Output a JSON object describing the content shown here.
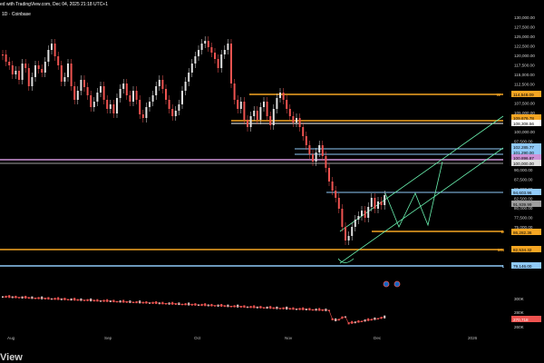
{
  "header": {
    "line1": "ed with TradingView.com, Dec 04, 2025 21:18 UTC+1",
    "line2": "1D · Coinbase"
  },
  "price_axis": [
    "130,000.00",
    "127,500.00",
    "125,000.00",
    "122,500.00",
    "120,000.00",
    "117,500.00",
    "115,000.00",
    "112,500.00",
    "110,000.00",
    "107,500.00",
    "105,000.00",
    "102,500.00",
    "100,000.00",
    "97,500.00",
    "95,000.00",
    "92,500.00",
    "90,000.00",
    "87,500.00",
    "85,000.00",
    "82,500.00",
    "80,000.00",
    "77,500.00",
    "75,000.00"
  ],
  "volume_axis": [
    "300K",
    "280K",
    "260K"
  ],
  "time_axis": [
    "Aug",
    "Sep",
    "Oct",
    "Nov",
    "Dec",
    "2026"
  ],
  "price_tags": [
    {
      "text": "114,548.09",
      "bg": "#f5a623",
      "fg": "#000"
    },
    {
      "text": "109,676.78",
      "bg": "#f5a623",
      "fg": "#000"
    },
    {
      "text": "108,308.56",
      "bg": "#ffffff",
      "fg": "#000"
    },
    {
      "text": "102,285.77",
      "bg": "#90caf9",
      "fg": "#000"
    },
    {
      "text": "101,290.00",
      "bg": "#90caf9",
      "fg": "#000"
    },
    {
      "text": "100,896.87",
      "bg": "#ce93d8",
      "fg": "#000"
    },
    {
      "text": "100,000.00",
      "bg": "#e0e0e0",
      "fg": "#000"
    },
    {
      "text": "94,603.96",
      "bg": "#90caf9",
      "fg": "#000"
    },
    {
      "text": "91,939.99",
      "bg": "#9e9e9e",
      "fg": "#000"
    },
    {
      "text": "86,282.36",
      "bg": "#f5a623",
      "fg": "#000"
    },
    {
      "text": "82,534.32",
      "bg": "#f5a623",
      "fg": "#000"
    },
    {
      "text": "79,146.00",
      "bg": "#90caf9",
      "fg": "#000"
    },
    {
      "text": "270,718",
      "bg": "#ef5350",
      "fg": "#fff"
    }
  ],
  "level_labels": [
    "W",
    "D",
    "MN",
    "1"
  ],
  "footer": {
    "logo_text": "View"
  },
  "colors": {
    "orange": "#f5a623",
    "blue": "#90caf9",
    "purple": "#ce93d8",
    "green": "#69f0ae",
    "up": "#e0e0e0",
    "down": "#ef5350"
  }
}
